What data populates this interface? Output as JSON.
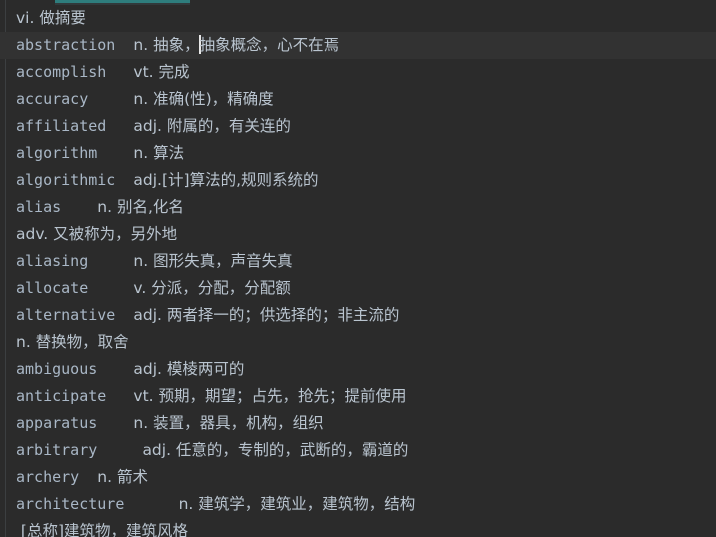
{
  "editor": {
    "theme_background": "#2b2b2b",
    "current_line_background": "#323232",
    "text_color": "#a9b7c6",
    "accent_color": "#2e7d7d",
    "caret_color": "#e8e8e8",
    "gutter_divider_color": "#3c3f41"
  },
  "lines": [
    {
      "id": "line-1",
      "word": "",
      "gloss_prefix": "vi. 做摘要",
      "gloss_suffix": "",
      "indent": "",
      "current": false,
      "caret": false
    },
    {
      "id": "line-2",
      "word": "abstraction",
      "gloss_prefix": "n. 抽象，",
      "gloss_suffix": "抽象概念，心不在焉",
      "indent": "  ",
      "current": true,
      "caret": true
    },
    {
      "id": "line-3",
      "word": "accomplish",
      "gloss_prefix": "vt. 完成",
      "gloss_suffix": "",
      "indent": "   ",
      "current": false,
      "caret": false
    },
    {
      "id": "line-4",
      "word": "accuracy",
      "gloss_prefix": "n. 准确(性)，精确度",
      "gloss_suffix": "",
      "indent": "     ",
      "current": false,
      "caret": false
    },
    {
      "id": "line-5",
      "word": "affiliated",
      "gloss_prefix": "adj. 附属的，有关连的",
      "gloss_suffix": "",
      "indent": "   ",
      "current": false,
      "caret": false
    },
    {
      "id": "line-6",
      "word": "algorithm",
      "gloss_prefix": "n. 算法",
      "gloss_suffix": "",
      "indent": "    ",
      "current": false,
      "caret": false
    },
    {
      "id": "line-7",
      "word": "algorithmic",
      "gloss_prefix": "adj.[计]算法的,规则系统的",
      "gloss_suffix": "",
      "indent": "  ",
      "current": false,
      "caret": false
    },
    {
      "id": "line-8",
      "word": "alias",
      "gloss_prefix": "n. 别名,化名",
      "gloss_suffix": "",
      "indent": "    ",
      "current": false,
      "caret": false
    },
    {
      "id": "line-9",
      "word": "",
      "gloss_prefix": "adv. 又被称为，另外地",
      "gloss_suffix": "",
      "indent": "",
      "current": false,
      "caret": false
    },
    {
      "id": "line-10",
      "word": "aliasing",
      "gloss_prefix": "n. 图形失真，声音失真",
      "gloss_suffix": "",
      "indent": "     ",
      "current": false,
      "caret": false
    },
    {
      "id": "line-11",
      "word": "allocate",
      "gloss_prefix": "v. 分派，分配，分配额",
      "gloss_suffix": "",
      "indent": "     ",
      "current": false,
      "caret": false
    },
    {
      "id": "line-12",
      "word": "alternative",
      "gloss_prefix": "adj. 两者择一的；供选择的；非主流的",
      "gloss_suffix": "",
      "indent": "  ",
      "current": false,
      "caret": false
    },
    {
      "id": "line-13",
      "word": "",
      "gloss_prefix": "n. 替换物，取舍",
      "gloss_suffix": "",
      "indent": "",
      "current": false,
      "caret": false
    },
    {
      "id": "line-14",
      "word": "ambiguous",
      "gloss_prefix": "adj. 模棱两可的",
      "gloss_suffix": "",
      "indent": "    ",
      "current": false,
      "caret": false
    },
    {
      "id": "line-15",
      "word": "anticipate",
      "gloss_prefix": "vt. 预期，期望；占先，抢先；提前使用",
      "gloss_suffix": "",
      "indent": "   ",
      "current": false,
      "caret": false
    },
    {
      "id": "line-16",
      "word": "apparatus",
      "gloss_prefix": "n. 装置，器具，机构，组织",
      "gloss_suffix": "",
      "indent": "    ",
      "current": false,
      "caret": false
    },
    {
      "id": "line-17",
      "word": "arbitrary",
      "gloss_prefix": "adj. 任意的，专制的，武断的，霸道的",
      "gloss_suffix": "",
      "indent": "     ",
      "current": false,
      "caret": false
    },
    {
      "id": "line-18",
      "word": "archery",
      "gloss_prefix": "n. 箭术",
      "gloss_suffix": "",
      "indent": "  ",
      "current": false,
      "caret": false
    },
    {
      "id": "line-19",
      "word": "architecture",
      "gloss_prefix": "n. 建筑学，建筑业，建筑物，结构",
      "gloss_suffix": "",
      "indent": "      ",
      "current": false,
      "caret": false
    },
    {
      "id": "line-20",
      "word": "",
      "gloss_prefix": " [总称]建筑物，建筑风格",
      "gloss_suffix": "",
      "indent": "",
      "current": false,
      "caret": false
    }
  ]
}
